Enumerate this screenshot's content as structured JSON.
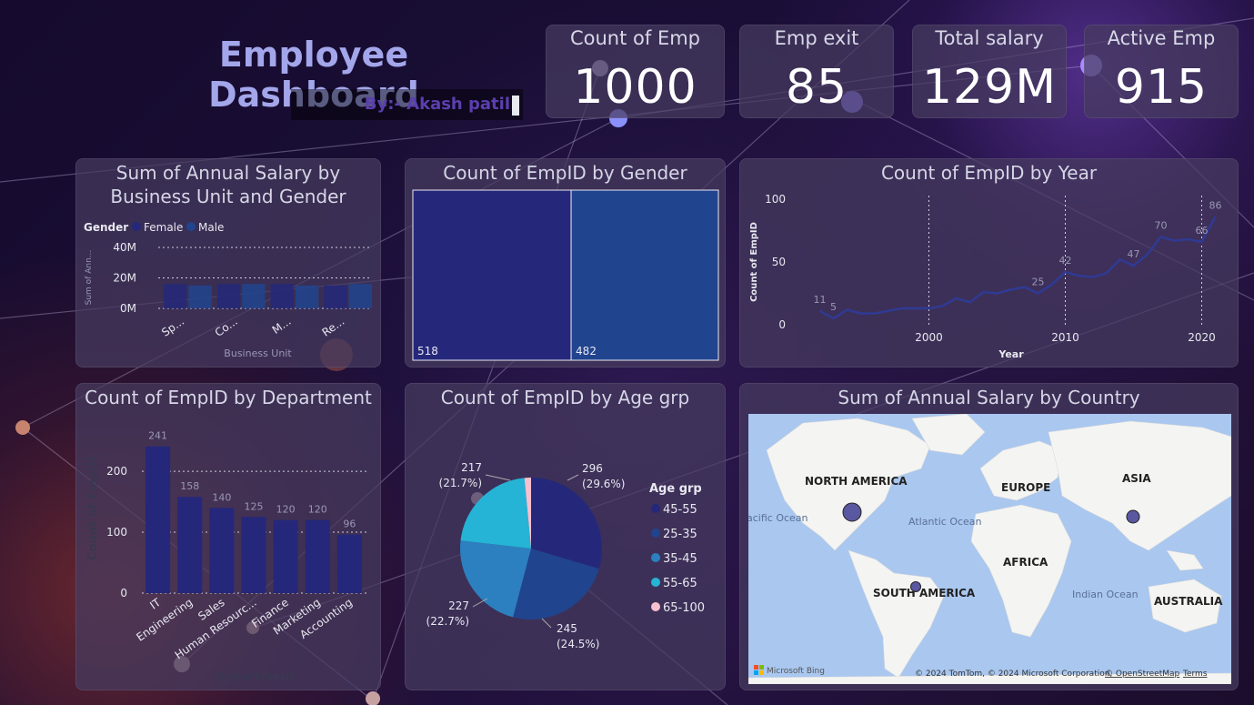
{
  "header": {
    "title": "Employee Dashboard",
    "byline": "By:- Akash patil"
  },
  "kpis": [
    {
      "label": "Count of Emp",
      "value": "1000"
    },
    {
      "label": "Emp exit",
      "value": "85"
    },
    {
      "label": "Total salary",
      "value": "129M"
    },
    {
      "label": "Active Emp",
      "value": "915"
    }
  ],
  "colors": {
    "navy": "#25287a",
    "blue": "#21448f",
    "mid": "#2c80c0",
    "cyan": "#25b4d6",
    "pink": "#f7c0d0",
    "line": "#2f3a94"
  },
  "chart_data": [
    {
      "id": "salary_bu_gender",
      "type": "bar",
      "title": "Sum of Annual Salary by Business Unit and Gender",
      "legend_title": "Gender",
      "xlabel": "Business Unit",
      "ylabel": "Sum of Ann...",
      "yticks": [
        "0M",
        "20M",
        "40M"
      ],
      "ylim": [
        0,
        40
      ],
      "categories": [
        "Sp...",
        "Co...",
        "M...",
        "Re..."
      ],
      "series": [
        {
          "name": "Female",
          "values": [
            16,
            16,
            16,
            15
          ]
        },
        {
          "name": "Male",
          "values": [
            15,
            16,
            15,
            16
          ]
        }
      ]
    },
    {
      "id": "gender_count",
      "type": "treemap",
      "title": "Count of EmpID by Gender",
      "values": [
        518,
        482
      ]
    },
    {
      "id": "year_count",
      "type": "line",
      "title": "Count of EmpID by Year",
      "xlabel": "Year",
      "ylabel": "Count of EmpID",
      "yticks": [
        "0",
        "50",
        "100"
      ],
      "xticks": [
        "2000",
        "2010",
        "2020"
      ],
      "ylim": [
        0,
        100
      ],
      "xlim": [
        1990.5,
        2021.5
      ],
      "x": [
        1992,
        1993,
        1994,
        1995,
        1996,
        1997,
        1998,
        1999,
        2000,
        2001,
        2002,
        2003,
        2004,
        2005,
        2006,
        2007,
        2008,
        2009,
        2010,
        2011,
        2012,
        2013,
        2014,
        2015,
        2016,
        2017,
        2018,
        2019,
        2020,
        2021
      ],
      "y": [
        11,
        5,
        12,
        9,
        9,
        11,
        13,
        13,
        13,
        15,
        21,
        18,
        26,
        25,
        28,
        30,
        25,
        32,
        42,
        39,
        38,
        41,
        52,
        47,
        56,
        70,
        67,
        68,
        66,
        86
      ],
      "point_labels": [
        {
          "x": 1992,
          "text": "11"
        },
        {
          "x": 1993,
          "text": "5"
        },
        {
          "x": 2008,
          "text": "25"
        },
        {
          "x": 2010,
          "text": "42"
        },
        {
          "x": 2015,
          "text": "47"
        },
        {
          "x": 2017,
          "text": "70"
        },
        {
          "x": 2020,
          "text": "66"
        },
        {
          "x": 2021,
          "text": "86"
        }
      ]
    },
    {
      "id": "dept_count",
      "type": "bar",
      "title": "Count of EmpID by Department",
      "xlabel": "Department",
      "ylabel": "Count of EmpID",
      "yticks": [
        "0",
        "100",
        "200"
      ],
      "ylim": [
        0,
        245
      ],
      "categories": [
        "IT",
        "Engineering",
        "Sales",
        "Human Resourc...",
        "Finance",
        "Marketing",
        "Accounting"
      ],
      "values": [
        241,
        158,
        140,
        125,
        120,
        120,
        96
      ]
    },
    {
      "id": "age_grp",
      "type": "pie",
      "title": "Count of EmpID by Age grp",
      "legend_title": "Age grp",
      "categories": [
        "45-55",
        "25-35",
        "35-45",
        "55-65",
        "65-100"
      ],
      "values": [
        296,
        245,
        227,
        217,
        15
      ],
      "slice_labels": [
        "296 (29.6%)",
        "245 (24.5%)",
        "227 (22.7%)",
        "217 (21.7%)",
        ""
      ]
    }
  ],
  "map": {
    "title": "Sum of Annual Salary by Country",
    "labels": [
      "NORTH AMERICA",
      "EUROPE",
      "ASIA",
      "AFRICA",
      "SOUTH AMERICA",
      "AUSTRALIA"
    ],
    "oceans": [
      "Atlantic Ocean",
      "Indian Ocean",
      "acific Ocean"
    ],
    "attribution": "© 2024 TomTom, © 2024 Microsoft Corporation,",
    "osm": "© OpenStreetMap",
    "terms": "Terms",
    "brand": "Microsoft Bing"
  }
}
